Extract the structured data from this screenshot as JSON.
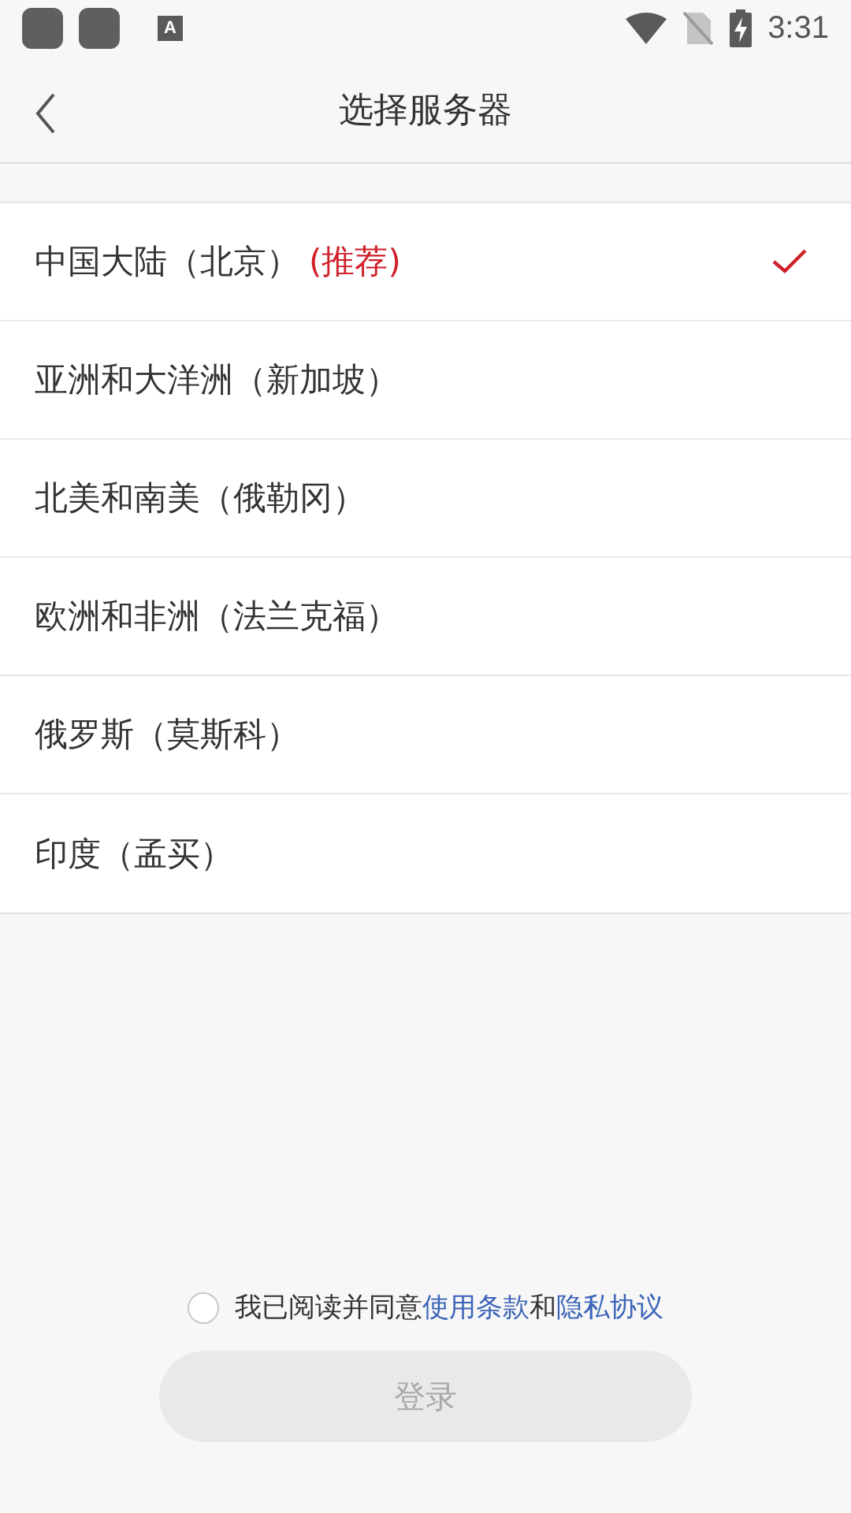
{
  "status_bar": {
    "time": "3:31",
    "notification_badge": "A"
  },
  "header": {
    "title": "选择服务器"
  },
  "servers": [
    {
      "name": "中国大陆（北京）",
      "tag": "(推荐)",
      "selected": true
    },
    {
      "name": "亚洲和大洋洲（新加坡）",
      "selected": false
    },
    {
      "name": "北美和南美（俄勒冈）",
      "selected": false
    },
    {
      "name": "欧洲和非洲（法兰克福）",
      "selected": false
    },
    {
      "name": "俄罗斯（莫斯科）",
      "selected": false
    },
    {
      "name": "印度（孟买）",
      "selected": false
    }
  ],
  "agreement": {
    "checked": false,
    "prefix": "我已阅读并同意",
    "terms_link": "使用条款",
    "joiner": "和",
    "privacy_link": "隐私协议"
  },
  "login_button": {
    "label": "登录",
    "disabled": true
  }
}
